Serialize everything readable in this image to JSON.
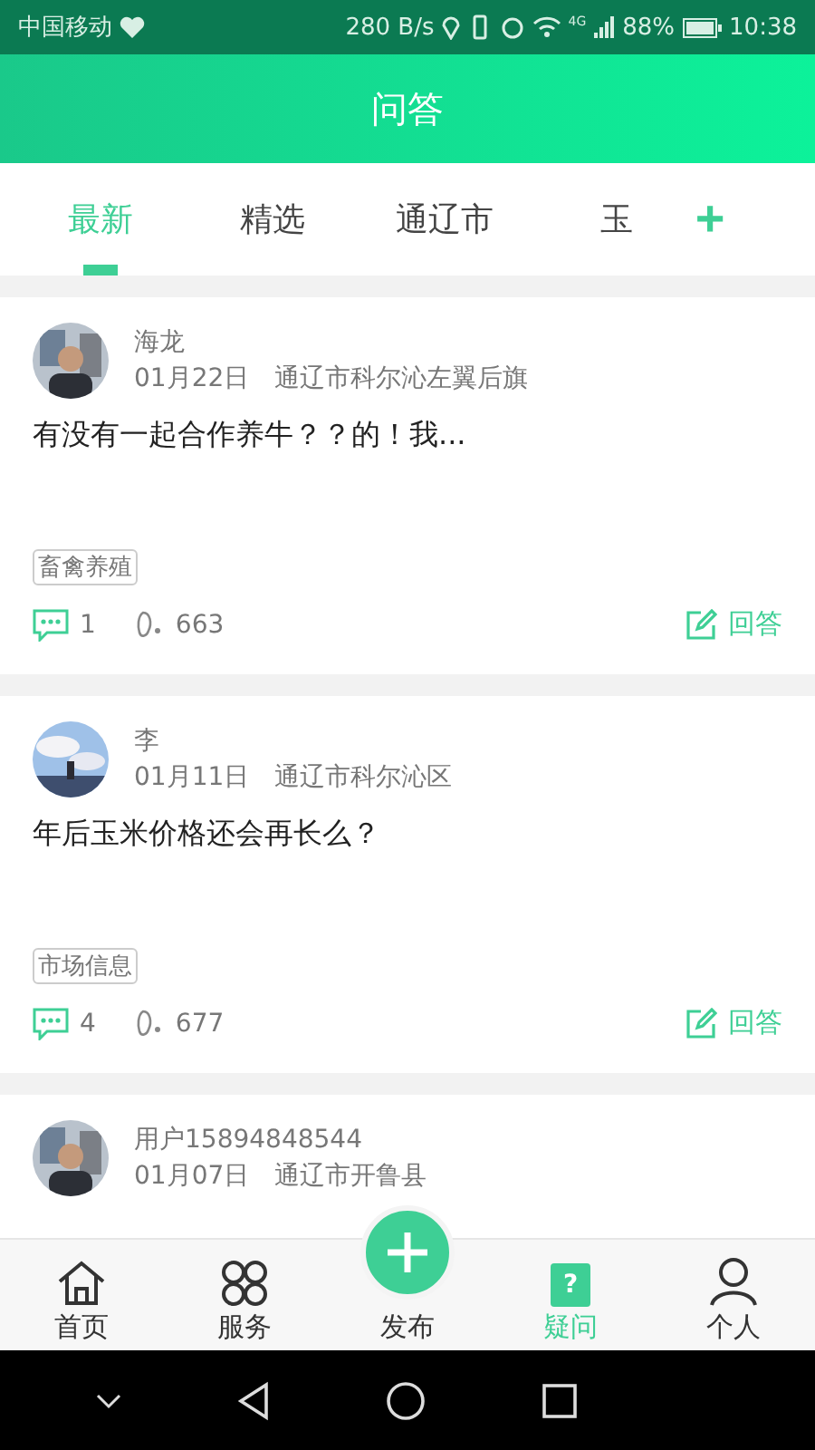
{
  "status_bar": {
    "carrier": "中国移动",
    "speed": "280 B/s",
    "network": "4G",
    "battery": "88%",
    "time": "10:38"
  },
  "header": {
    "title": "问答"
  },
  "tabs": [
    {
      "label": "最新",
      "selected": true
    },
    {
      "label": "精选",
      "selected": false
    },
    {
      "label": "通辽市",
      "selected": false
    },
    {
      "label": "玉",
      "selected": false
    }
  ],
  "add_tab": "+",
  "posts": [
    {
      "author": "海龙",
      "date": "01月22日",
      "location": "通辽市科尔沁左翼后旗",
      "text": "有没有一起合作养牛？？的！我...",
      "tag": "畜禽养殖",
      "comments": "1",
      "views": "663",
      "answer": "回答"
    },
    {
      "author": "李",
      "date": "01月11日",
      "location": "通辽市科尔沁区",
      "text": "年后玉米价格还会再长么？",
      "tag": "市场信息",
      "comments": "4",
      "views": "677",
      "answer": "回答"
    },
    {
      "author": "用户15894848544",
      "date": "01月07日",
      "location": "通辽市开鲁县"
    }
  ],
  "bottom_nav": [
    {
      "label": "首页",
      "kind": "home",
      "selected": false
    },
    {
      "label": "服务",
      "kind": "grid",
      "selected": false
    },
    {
      "label": "发布",
      "kind": "fab",
      "selected": false
    },
    {
      "label": "疑问",
      "kind": "question",
      "glyph": "?",
      "selected": true
    },
    {
      "label": "个人",
      "kind": "person",
      "selected": false
    }
  ]
}
